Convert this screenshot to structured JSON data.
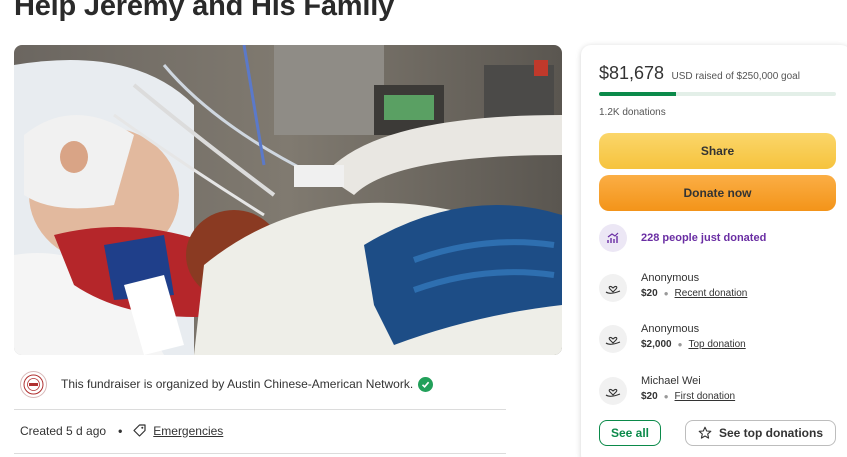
{
  "page": {
    "title": "Help Jeremy and His Family"
  },
  "organizer": {
    "text": "This fundraiser is organized by Austin Chinese-American Network.",
    "logo_icon": "organization-logo-icon",
    "verified_icon": "verified-check-icon"
  },
  "meta": {
    "created": "Created 5 d ago",
    "separator": "•",
    "category": "Emergencies",
    "category_icon": "tag-icon"
  },
  "donation_panel": {
    "amount_raised": "$81,678",
    "goal_text": "USD raised of $250,000 goal",
    "progress_fraction": 0.327,
    "donation_count": "1.2K donations",
    "share_label": "Share",
    "donate_label": "Donate now",
    "momentum_text": "228 people just donated",
    "momentum_icon": "trending-up-icon",
    "donations": [
      {
        "name": "Anonymous",
        "amount": "$20",
        "type": "Recent donation"
      },
      {
        "name": "Anonymous",
        "amount": "$2,000",
        "type": "Top donation"
      },
      {
        "name": "Michael Wei",
        "amount": "$20",
        "type": "First donation"
      }
    ],
    "donation_icon": "heart-hand-icon",
    "see_all_label": "See all",
    "see_top_label": "See top donations",
    "star_icon": "star-icon"
  },
  "colors": {
    "brand_green": "#0b8a4a",
    "share_yellow": "#f6c33d",
    "donate_orange": "#f39419",
    "momentum_purple": "#6a2ea3"
  }
}
